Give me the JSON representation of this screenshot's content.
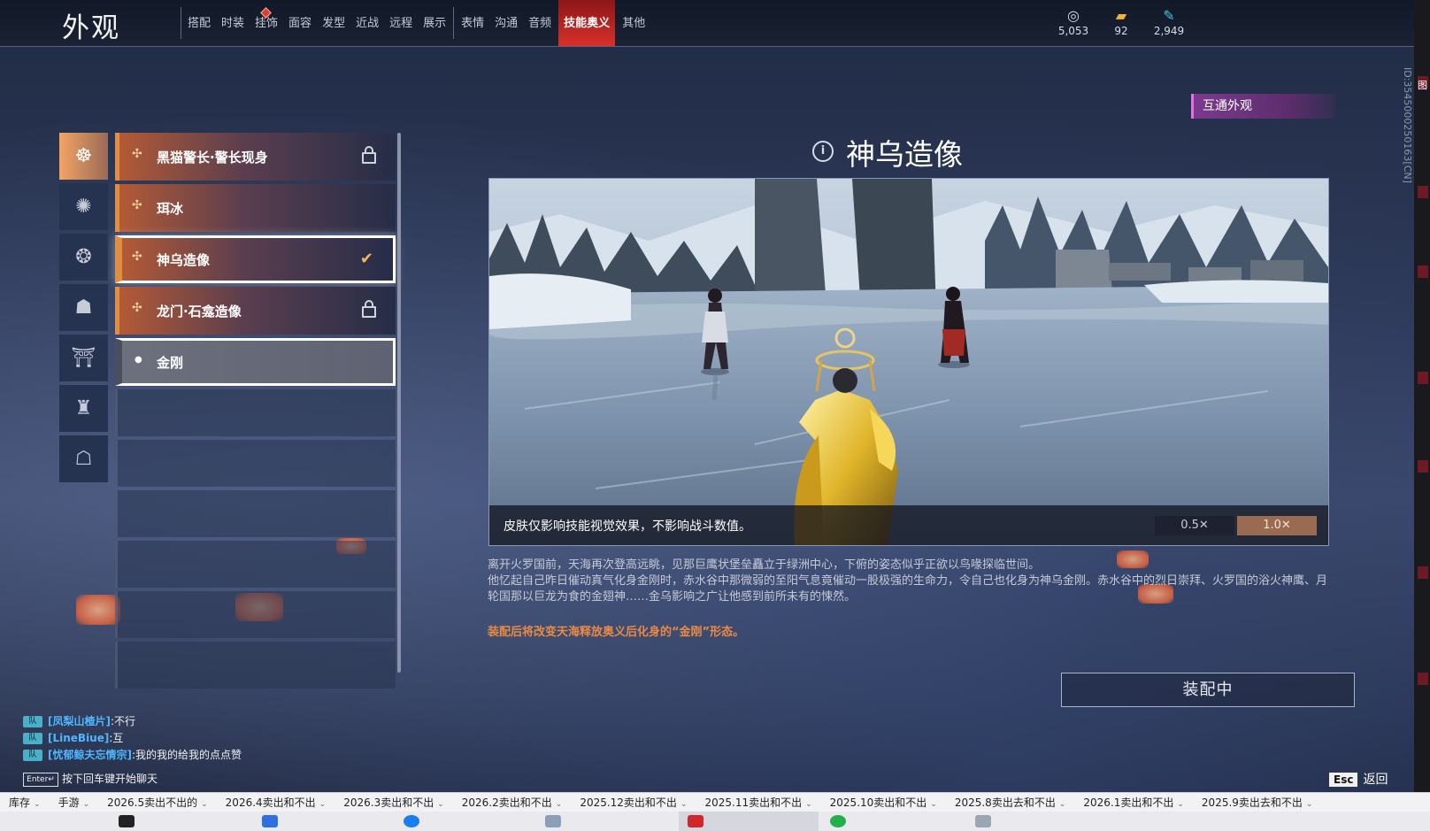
{
  "header": {
    "title": "外观",
    "tabs": [
      {
        "label": "搭配"
      },
      {
        "label": "时装"
      },
      {
        "label": "挂饰",
        "badge": true
      },
      {
        "label": "面容"
      },
      {
        "label": "发型"
      },
      {
        "label": "近战"
      },
      {
        "label": "远程"
      },
      {
        "label": "展示"
      },
      {
        "label": "表情"
      },
      {
        "label": "沟通"
      },
      {
        "label": "音频"
      },
      {
        "label": "技能奥义",
        "active": true
      },
      {
        "label": "其他"
      }
    ],
    "currencies": [
      {
        "icon": "coin-stack-icon",
        "value": "5,053"
      },
      {
        "icon": "ticket-icon",
        "value": "92"
      },
      {
        "icon": "feather-icon",
        "value": "2,949"
      }
    ]
  },
  "side_id": "ID:3545000250163[CN]",
  "side_id_char": "图",
  "categories": [
    {
      "icon": "skill-form-icon-1",
      "active": true
    },
    {
      "icon": "skill-form-icon-2"
    },
    {
      "icon": "skill-form-icon-3"
    },
    {
      "icon": "skill-form-icon-4"
    },
    {
      "icon": "skill-form-icon-5"
    },
    {
      "icon": "skill-form-icon-6"
    },
    {
      "icon": "skill-form-icon-7"
    }
  ],
  "skins": [
    {
      "name": "黑猫警长·警长现身",
      "locked": true
    },
    {
      "name": "珥冰",
      "locked": false
    },
    {
      "name": "神乌造像",
      "selected": true
    },
    {
      "name": "龙门·石龛造像",
      "locked": true
    },
    {
      "name": "金刚",
      "default": true
    }
  ],
  "detail": {
    "badge": "互通外观",
    "title": "神乌造像",
    "caption": "皮肤仅影响技能视觉效果，不影响战斗数值。",
    "speed_options": [
      "0.5✕",
      "1.0✕"
    ],
    "selected_speed": "1.0✕",
    "description_lines": [
      "离开火罗国前，天海再次登高远眺，见那巨鹰状堡垒矗立于绿洲中心，下俯的姿态似乎正欲以鸟喙探临世间。",
      "他忆起自己昨日催动真气化身金刚时，赤水谷中那微弱的至阳气息竟催动一股极强的生命力，令自己也化身为神乌金刚。赤水谷中的烈日崇拜、火罗国的浴火神鹰、月轮国那以巨龙为食的金翅神……金乌影响之广让他感到前所未有的悚然。"
    ],
    "note": "装配后将改变天海释放奥义后化身的“金刚”形态。",
    "equip_button": "装配中"
  },
  "chat": {
    "channel_label": "队",
    "messages": [
      {
        "who": "[凤梨山楂片]",
        "text": ":不行"
      },
      {
        "who": "[LineBiue]",
        "text": ":互"
      },
      {
        "who": "[忧郁鲸夫忘情宗]",
        "text": ":我的我的给我的点点赞"
      }
    ],
    "enter_key": "Enter↵",
    "hint": "按下回车键开始聊天"
  },
  "esc": {
    "key": "Esc",
    "label": "返回"
  },
  "bookmarks": [
    "库存",
    "手游",
    "2026.5卖出不出的",
    "2026.4卖出和不出",
    "2026.3卖出和不出",
    "2026.2卖出和不出",
    "2025.12卖出和不出",
    "2025.11卖出和不出",
    "2025.10卖出和不出",
    "2025.8卖出去和不出",
    "2026.1卖出和不出",
    "2025.9卖出去和不出"
  ],
  "colors": {
    "accent_red": "#d8302b",
    "accent_orange": "#e08e42",
    "note_orange": "#e88a45",
    "badge_purple": "#7c3a8e",
    "chat_name_blue": "#4fb6ff"
  }
}
